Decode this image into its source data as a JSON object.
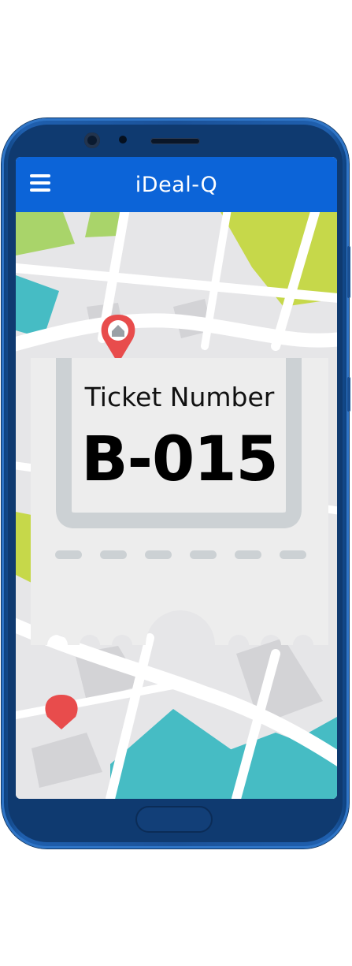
{
  "app": {
    "title": "iDeal-Q"
  },
  "ticket": {
    "label": "Ticket Number",
    "number": "B-015"
  },
  "colors": {
    "appbar": "#0c64d8",
    "phone_body": "#1b5299",
    "map_road": "#ffffff",
    "map_block": "#e6e6e8",
    "map_park": "#c6d84a",
    "map_water": "#46bcc4",
    "pin": "#e84c4c",
    "ticket": "#ededed"
  },
  "icons": [
    "menu-icon",
    "home-pin-icon",
    "location-pin-icon"
  ]
}
